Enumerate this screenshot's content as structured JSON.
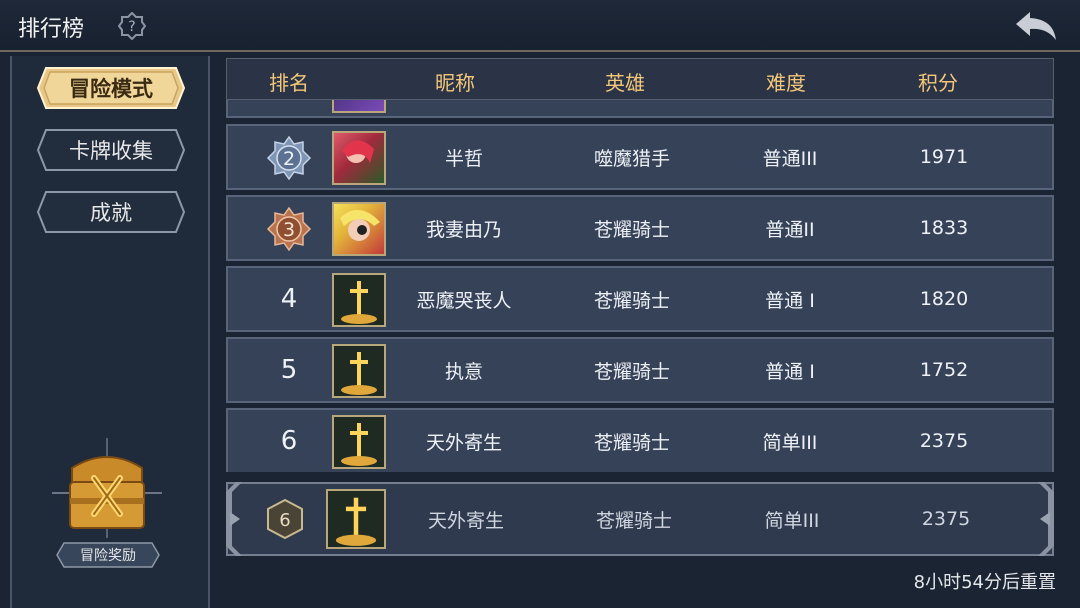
{
  "header": {
    "title": "排行榜",
    "help_icon": "help-question-icon",
    "back_icon": "back-arrow-icon"
  },
  "sidebar": {
    "items": [
      {
        "label": "冒险模式",
        "active": true
      },
      {
        "label": "卡牌收集",
        "active": false
      },
      {
        "label": "成就",
        "active": false
      }
    ],
    "reward_label": "冒险奖励",
    "reward_icon": "treasure-chest-icon"
  },
  "table": {
    "columns": [
      "排名",
      "昵称",
      "英雄",
      "难度",
      "积分"
    ],
    "rows": [
      {
        "rank": "2",
        "name": "半哲",
        "hero": "噬魔猎手",
        "difficulty": "普通III",
        "score": "1971",
        "medal": "silver",
        "avatar": "red-hair-character"
      },
      {
        "rank": "3",
        "name": "我妻由乃",
        "hero": "苍耀骑士",
        "difficulty": "普通II",
        "score": "1833",
        "medal": "bronze",
        "avatar": "blonde-character"
      },
      {
        "rank": "4",
        "name": "恶魔哭丧人",
        "hero": "苍耀骑士",
        "difficulty": "普通 I",
        "score": "1820",
        "medal": "",
        "avatar": "golden-sword"
      },
      {
        "rank": "5",
        "name": "执意",
        "hero": "苍耀骑士",
        "difficulty": "普通 I",
        "score": "1752",
        "medal": "",
        "avatar": "golden-sword"
      },
      {
        "rank": "6",
        "name": "天外寄生",
        "hero": "苍耀骑士",
        "difficulty": "简单III",
        "score": "2375",
        "medal": "",
        "avatar": "golden-sword"
      }
    ]
  },
  "self_row": {
    "rank": "6",
    "name": "天外寄生",
    "hero": "苍耀骑士",
    "difficulty": "简单III",
    "score": "2375",
    "avatar": "golden-sword"
  },
  "reset_note": "8小时54分后重置",
  "colors": {
    "accent_gold": "#f4c77a",
    "row_bg": "#354258",
    "bg": "#1b2433"
  }
}
